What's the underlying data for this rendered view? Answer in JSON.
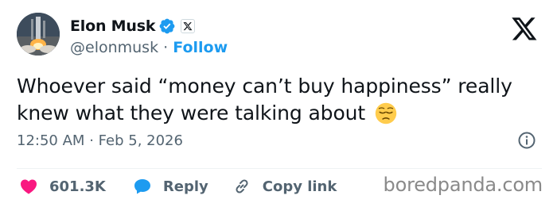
{
  "author": {
    "name": "Elon Musk",
    "handle": "@elonmusk",
    "separator": "·",
    "follow_label": "Follow",
    "avatar_icon": "rocket-launch-avatar"
  },
  "tweet": {
    "text": "Whoever said “money can’t buy happiness” really knew what they were talking about",
    "emoji": "pensive-face-emoji",
    "time": "12:50 AM",
    "date_separator": "·",
    "date": "Feb 5, 2026"
  },
  "actions": {
    "likes_count": "601.3K",
    "reply_label": "Reply",
    "copy_link_label": "Copy link"
  },
  "watermark": "boredpanda.com",
  "colors": {
    "accent_blue": "#1d9bf0",
    "like_pink": "#f91880",
    "muted_text": "#536471",
    "text": "#0f1419"
  }
}
